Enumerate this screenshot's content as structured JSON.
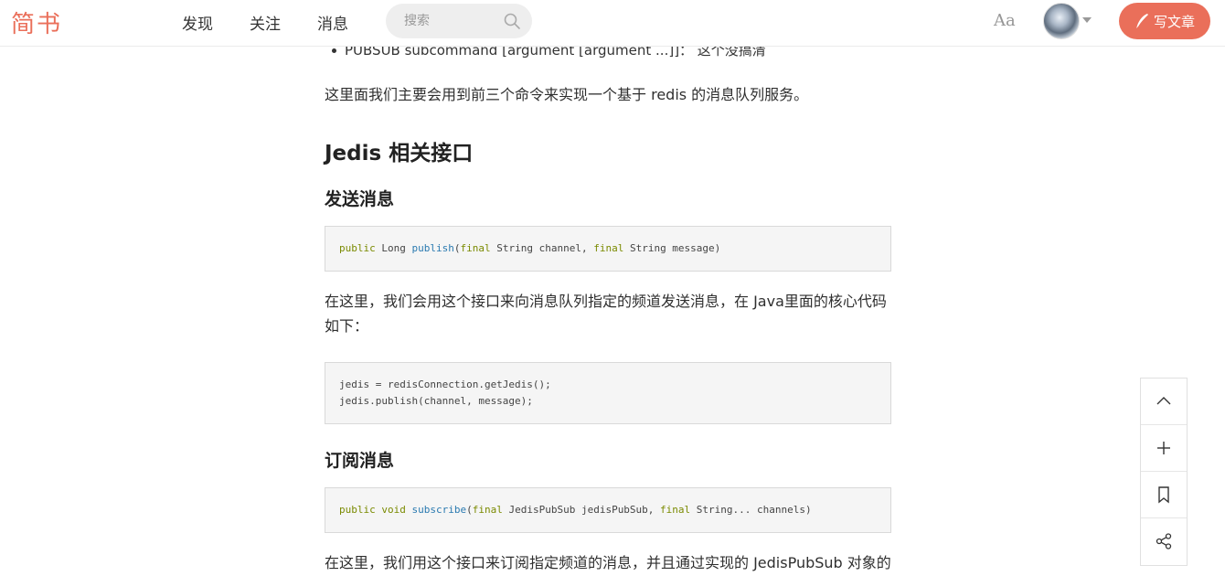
{
  "header": {
    "logo": "简书",
    "nav": [
      "发现",
      "关注",
      "消息"
    ],
    "search_placeholder": "搜索",
    "font_toggle": "Aa",
    "write_button": "写文章"
  },
  "article": {
    "bullet_text": "PUBSUB subcommand [argument [argument ...]]： 这个没搞清",
    "para1": "这里面我们主要会用到前三个命令来实现一个基于 redis 的消息队列服务。",
    "heading_jedis": "Jedis 相关接口",
    "heading_send": "发送消息",
    "code_publish": {
      "t1": "public",
      "t2": " Long ",
      "t3": "publish",
      "t4": "(",
      "t5": "final",
      "t6": " String channel, ",
      "t7": "final",
      "t8": " String message)"
    },
    "para2": "在这里，我们会用这个接口来向消息队列指定的频道发送消息，在 Java里面的核心代码如下：",
    "code_java": [
      "jedis = redisConnection.getJedis();",
      "jedis.publish(channel, message);"
    ],
    "heading_subscribe": "订阅消息",
    "code_subscribe": {
      "t1": "public",
      "t2": " ",
      "t3": "void",
      "t4": " ",
      "t5": "subscribe",
      "t6": "(",
      "t7": "final",
      "t8": " JedisPubSub jedisPubSub, ",
      "t9": "final",
      "t10": " String... channels)"
    },
    "para3": "在这里，我们用这个接口来订阅指定频道的消息，并且通过实现的 JedisPubSub 对象的"
  },
  "side_tools": [
    "chevron-up-icon",
    "plus-icon",
    "bookmark-icon",
    "share-icon"
  ],
  "colors": {
    "brand": "#ea6f5a",
    "keyword": "#7a8a00",
    "function": "#2a7ab0"
  }
}
